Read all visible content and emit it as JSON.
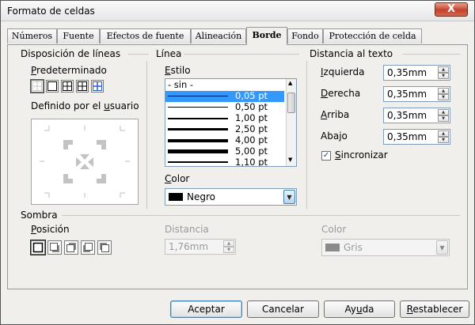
{
  "window": {
    "title": "Formato de celdas",
    "close_label": "X"
  },
  "tabs": [
    {
      "label": "Números",
      "active": false
    },
    {
      "label": "Fuente",
      "active": false
    },
    {
      "label": "Efectos de fuente",
      "active": false
    },
    {
      "label": "Alineación",
      "active": false
    },
    {
      "label": "Borde",
      "active": true
    },
    {
      "label": "Fondo",
      "active": false
    },
    {
      "label": "Protección de celda",
      "active": false
    }
  ],
  "line_arrangement": {
    "heading": "Disposición de líneas",
    "default_label": "Predeterminado",
    "default_mnemonic": "P",
    "default_rest": "redeterminado",
    "user_defined_label_pre": "Definido por el ",
    "user_defined_mnemonic": "u",
    "user_defined_label_post": "suario"
  },
  "line": {
    "heading": "Línea",
    "style_mnemonic": "E",
    "style_rest": "stilo",
    "styles": [
      {
        "label": "- sin -",
        "thickness": 0
      },
      {
        "label": "0,05 pt",
        "thickness": 1,
        "selected": true
      },
      {
        "label": "0,50 pt",
        "thickness": 1
      },
      {
        "label": "1,00 pt",
        "thickness": 2
      },
      {
        "label": "2,50 pt",
        "thickness": 3
      },
      {
        "label": "4,00 pt",
        "thickness": 4
      },
      {
        "label": "5,00 pt",
        "thickness": 5
      },
      {
        "label": "1,10 pt",
        "thickness": 2
      }
    ],
    "color_mnemonic": "C",
    "color_rest": "olor",
    "color_value": "Negro",
    "color_swatch": "#000000"
  },
  "spacing": {
    "heading": "Distancia al texto",
    "left": {
      "mnemonic": "I",
      "rest": "zquierda",
      "value": "0,35mm"
    },
    "right": {
      "mnemonic": "D",
      "rest": "erecha",
      "value": "0,35mm"
    },
    "top": {
      "mnemonic": "A",
      "rest": "rriba",
      "value": "0,35mm"
    },
    "bottom": {
      "pre": "Aba",
      "mnemonic": "j",
      "rest": "o",
      "value": "0,35mm"
    },
    "sync_mnemonic": "S",
    "sync_rest": "incronizar",
    "sync_checked": "✓"
  },
  "shadow": {
    "heading": "Sombra",
    "position_mnemonic": "P",
    "position_rest": "osición",
    "distance_label": "Distancia",
    "distance_value": "1,76mm",
    "color_label": "Color",
    "color_value": "Gris",
    "color_swatch": "#8a8a8a"
  },
  "buttons": {
    "ok": "Aceptar",
    "cancel": "Cancelar",
    "help_pre": "Ay",
    "help_mnemonic": "u",
    "help_post": "da",
    "reset_mnemonic": "R",
    "reset_rest": "establecer"
  }
}
